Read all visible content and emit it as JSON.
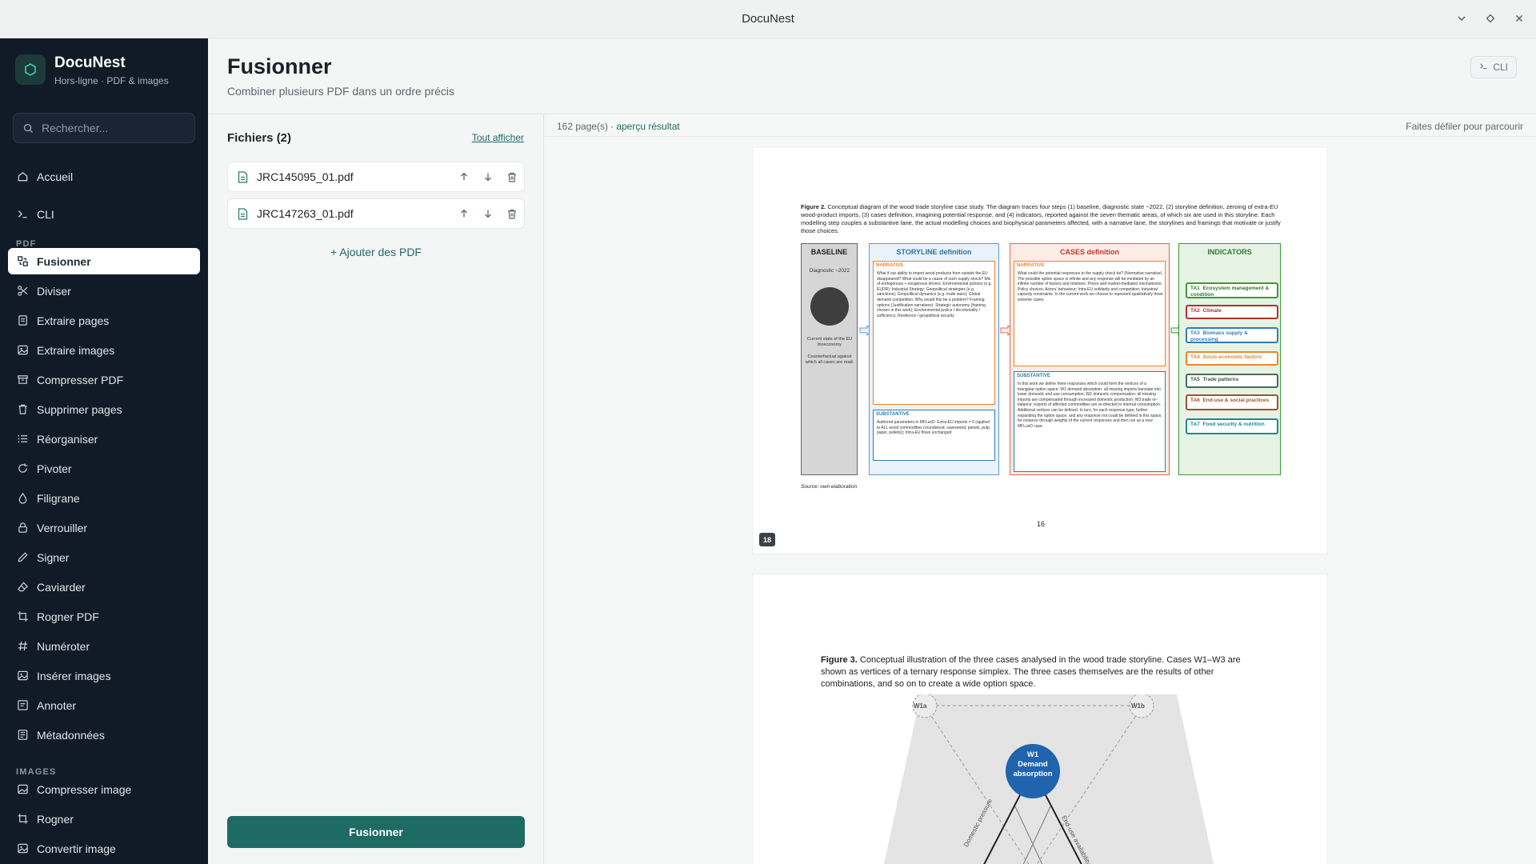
{
  "window": {
    "title": "DocuNest"
  },
  "brand": {
    "name": "DocuNest",
    "subtitle": "Hors-ligne · PDF & images"
  },
  "search": {
    "placeholder": "Rechercher..."
  },
  "nav": {
    "top": [
      {
        "label": "Accueil",
        "icon": "home-icon"
      },
      {
        "label": "CLI",
        "icon": "terminal-icon"
      }
    ],
    "pdf_section": "PDF",
    "pdf": [
      {
        "label": "Fusionner",
        "icon": "merge-icon",
        "active": true
      },
      {
        "label": "Diviser",
        "icon": "scissors-icon"
      },
      {
        "label": "Extraire pages",
        "icon": "extract-pages-icon"
      },
      {
        "label": "Extraire images",
        "icon": "image-icon"
      },
      {
        "label": "Compresser PDF",
        "icon": "archive-icon"
      },
      {
        "label": "Supprimer pages",
        "icon": "trash-icon"
      },
      {
        "label": "Réorganiser",
        "icon": "list-order-icon"
      },
      {
        "label": "Pivoter",
        "icon": "rotate-icon"
      },
      {
        "label": "Filigrane",
        "icon": "droplet-icon"
      },
      {
        "label": "Verrouiller",
        "icon": "lock-icon"
      },
      {
        "label": "Signer",
        "icon": "pen-icon"
      },
      {
        "label": "Caviarder",
        "icon": "eraser-icon"
      },
      {
        "label": "Rogner PDF",
        "icon": "crop-icon"
      },
      {
        "label": "Numéroter",
        "icon": "hash-icon"
      },
      {
        "label": "Insérer images",
        "icon": "image-plus-icon"
      },
      {
        "label": "Annoter",
        "icon": "annotate-icon"
      },
      {
        "label": "Métadonnées",
        "icon": "info-icon"
      }
    ],
    "images_section": "IMAGES",
    "images": [
      {
        "label": "Compresser image",
        "icon": "image-compress-icon"
      },
      {
        "label": "Rogner",
        "icon": "crop-icon"
      },
      {
        "label": "Convertir image",
        "icon": "image-convert-icon"
      }
    ]
  },
  "header": {
    "title": "Fusionner",
    "subtitle": "Combiner plusieurs PDF dans un ordre précis",
    "cli_label": "CLI"
  },
  "files": {
    "title": "Fichiers (2)",
    "show_all": "Tout afficher",
    "items": [
      {
        "name": "JRC145095_01.pdf"
      },
      {
        "name": "JRC147263_01.pdf"
      }
    ],
    "add_label": "+ Ajouter des PDF",
    "merge_label": "Fusionner"
  },
  "preview": {
    "page_count": "162 page(s)",
    "result_label": "· aperçu résultat",
    "scroll_hint": "Faites défiler pour parcourir",
    "page1": {
      "badge": "18",
      "number": "16",
      "caption_bold": "Figure 2.",
      "caption": "Conceptual diagram of the wood trade storyline case study. The diagram traces four steps (1) baseline, diagnostic state ~2022, (2) storyline definition, zeroing of extra-EU wood-product imports, (3) cases definition, imagining potential response, and (4) indicators, reported against the seven thematic areas, of which six are used in this storyline. Each modelling step couples a substantive lane, the actual modelling choices and biophysical parameters affected, with a narrative lane, the storylines and framings that motivate or justify those choices.",
      "source": "Source: own elaboration",
      "baseline": {
        "title": "BASELINE",
        "state": "Diagnostic ~2022",
        "note1": "Current state of the EU bioeconomy",
        "note2": "Counterfactual against which all cases are read."
      },
      "storyline": {
        "title": "STORYLINE definition",
        "narrative": "NARRATIVE",
        "substantive": "SUBSTANTIVE",
        "narrative_text": "What if our ability to import wood products from outside the EU disappeared? What could be a cause of such supply shock? Mix of endogenous + exogenous drivers: Environmental policies (e.g. EUDR); Industrial Strategy; Geopolitical strategies (e.g. sanctions); Geopolitical dynamics (e.g. trade wars); Global demand competition. Why would this be a problem? Framing options (Justification narratives): Strategic autonomy (framing chosen in this work); Environmental justice / decoloniality / sufficiency; Resilience / geopolitical security",
        "substantive_text": "Authored parameters in MFLuxD: Extra-EU imports = 0 (applied to ALL wood commodities (roundwood, sawnwood, panels, pulp, paper, pellets)); Intra-EU flows unchanged"
      },
      "cases": {
        "title": "CASES definition",
        "narrative": "NARRATIVE",
        "substantive": "SUBSTANTIVE",
        "narrative_text": "What could the potential responses to the supply shock be? (Normative narrative). The possible option space is infinite and any response will be mediated by an infinite number of factors and relations: Prices and market-mediated mechanisms; Policy choices; Actors' behaviour; Intra-EU solidarity and competition; Industrial capacity constraints. In the current work we choose to represent qualitatively three extreme cases",
        "substantive_text": "In this work we define three responses which could form the vertices of a triangular option space: W1 demand absorption: all missing imports translate into lower domestic end-use consumption; W2 domestic compensation: all missing imports are compensated through increased domestic production; W3 trade re-balance: exports of affected commodities are re-directed to internal consumption. Additional vertices can be defined. In turn, for each response type, further expanding the option space, and any response not could be defined in this space, for instance through weights of the current responses and then run as a new MFLuxD case."
      },
      "indicators": {
        "title": "INDICATORS",
        "items": [
          {
            "code": "TA1",
            "label": "Ecosystem management & condition",
            "color": "#3a9a3a"
          },
          {
            "code": "TA2",
            "label": "Climate",
            "color": "#b03030"
          },
          {
            "code": "TA3",
            "label": "Biomass supply & processing",
            "color": "#2c7fb8"
          },
          {
            "code": "TA4",
            "label": "Socio-economic factors",
            "color": "#e8862a"
          },
          {
            "code": "TA5",
            "label": "Trade patterns",
            "color": "#4a6a55"
          },
          {
            "code": "TA6",
            "label": "End-use & social practices",
            "color": "#a0522d"
          },
          {
            "code": "TA7",
            "label": "Food security & nutrition",
            "color": "#1b8a8a"
          }
        ]
      }
    },
    "page2": {
      "caption_bold": "Figure 3.",
      "caption": "Conceptual illustration of the three cases analysed in the wood trade storyline. Cases W1–W3 are shown as vertices of a ternary response simplex. The three cases themselves are the results of other combinations, and so on to create a wide option space.",
      "w1a": "W1a",
      "w1b": "W1b",
      "w1_title": "W1",
      "w1_line1": "Demand",
      "w1_line2": "absorption",
      "left_axis": "Domestic pressure",
      "right_axis": "End-use availability"
    }
  }
}
